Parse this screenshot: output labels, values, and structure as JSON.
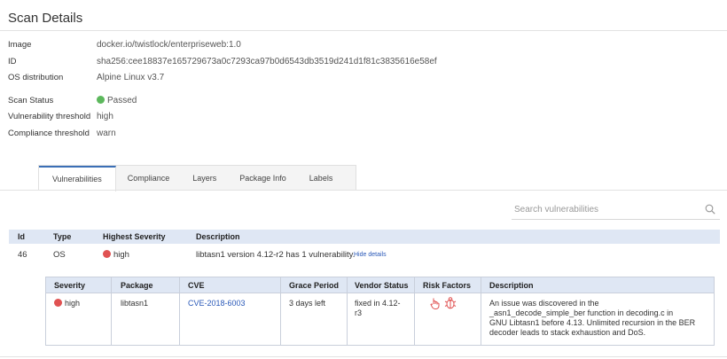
{
  "page": {
    "title": "Scan Details"
  },
  "details": {
    "image_label": "Image",
    "image_value": "docker.io/twistlock/enterpriseweb:1.0",
    "id_label": "ID",
    "id_value": "sha256:cee18837e165729673a0c7293ca97b0d6543db3519d241d1f81c3835616e58ef",
    "os_label": "OS distribution",
    "os_value": "Alpine Linux v3.7",
    "status_label": "Scan Status",
    "status_value": "Passed",
    "status_color": "#5cb85c",
    "vuln_threshold_label": "Vulnerability threshold",
    "vuln_threshold_value": "high",
    "compliance_threshold_label": "Compliance threshold",
    "compliance_threshold_value": "warn"
  },
  "tabs": [
    {
      "label": "Vulnerabilities",
      "active": true
    },
    {
      "label": "Compliance"
    },
    {
      "label": "Layers"
    },
    {
      "label": "Package Info"
    },
    {
      "label": "Labels"
    }
  ],
  "search": {
    "placeholder": "Search vulnerabilities",
    "icon": "search-icon"
  },
  "vulns_table": {
    "headers": [
      "Id",
      "Type",
      "Highest Severity",
      "Description"
    ],
    "row": {
      "id": "46",
      "type": "OS",
      "severity": "high",
      "severity_color": "#e05252",
      "description": "libtasn1 version 4.12-r2 has 1 vulnerability.",
      "toggle": "Hide details"
    }
  },
  "details_table": {
    "headers": [
      "Severity",
      "Package",
      "CVE",
      "Grace Period",
      "Vendor Status",
      "Risk Factors",
      "Description"
    ],
    "row": {
      "severity": "high",
      "package": "libtasn1",
      "cve": "CVE-2018-6003",
      "grace_period": "3 days left",
      "vendor_status_1": "fixed in 4.12-",
      "vendor_status_2": "r3",
      "risk_factor_icons": [
        "hand-pointer-icon",
        "bug-icon"
      ],
      "desc_1": "An issue was discovered in the",
      "desc_2": "_asn1_decode_simple_ber function in decoding.c in",
      "desc_3": "GNU Libtasn1 before 4.13. Unlimited recursion in the BER",
      "desc_4": "decoder leads to stack exhaustion and DoS."
    }
  }
}
